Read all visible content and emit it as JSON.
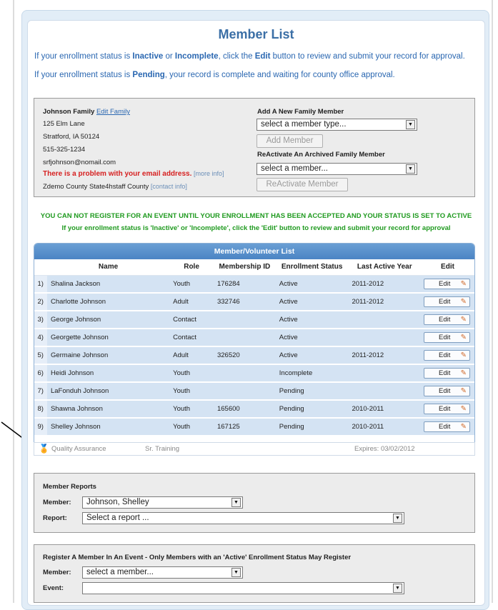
{
  "title": "Member List",
  "intro": {
    "line1_a": "If your enrollment status is ",
    "line1_inactive": "Inactive",
    "line1_or": " or ",
    "line1_incomplete": "Incomplete",
    "line1_b": ", click the ",
    "line1_edit": "Edit",
    "line1_c": " button to review and submit your record for approval.",
    "line2_a": "If your enrollment status is ",
    "line2_pending": "Pending",
    "line2_b": ", your record is complete and waiting for county office approval."
  },
  "family": {
    "name": "Johnson Family",
    "edit_link": "Edit Family",
    "address1": "125 Elm Lane",
    "address2": "Stratford, IA 50124",
    "phone": "515-325-1234",
    "email": "srfjohnson@nomail.com",
    "email_problem": "There is a problem with your email address.",
    "more_info": "[more info]",
    "county": "Zdemo County State4hstaff County",
    "contact_info": "[contact info]"
  },
  "add_member": {
    "label": "Add A New Family Member",
    "select_value": "select a member type...",
    "button": "Add Member"
  },
  "reactivate": {
    "label": "ReActivate An Archived Family Member",
    "select_value": "select a member...",
    "button": "ReActivate Member"
  },
  "warning": {
    "line1": "YOU CAN NOT REGISTER FOR AN EVENT UNTIL YOUR ENROLLMENT HAS BEEN ACCEPTED AND YOUR STATUS IS SET TO ACTIVE",
    "line2": "If your enrollment status is 'Inactive' or 'Incomplete', click the 'Edit' button to review and submit your record for approval"
  },
  "member_table": {
    "title": "Member/Volunteer List",
    "headers": [
      "Name",
      "Role",
      "Membership ID",
      "Enrollment Status",
      "Last Active Year",
      "Edit"
    ],
    "edit_label": "Edit",
    "rows": [
      {
        "num": "1)",
        "name": "Shalina Jackson",
        "role": "Youth",
        "id": "176284",
        "status": "Active",
        "year": "2011-2012"
      },
      {
        "num": "2)",
        "name": "Charlotte Johnson",
        "role": "Adult",
        "id": "332746",
        "status": "Active",
        "year": "2011-2012"
      },
      {
        "num": "3)",
        "name": "George Johnson",
        "role": "Contact",
        "id": "",
        "status": "Active",
        "year": ""
      },
      {
        "num": "4)",
        "name": "Georgette Johnson",
        "role": "Contact",
        "id": "",
        "status": "Active",
        "year": ""
      },
      {
        "num": "5)",
        "name": "Germaine Johnson",
        "role": "Adult",
        "id": "326520",
        "status": "Active",
        "year": "2011-2012"
      },
      {
        "num": "6)",
        "name": "Heidi Johnson",
        "role": "Youth",
        "id": "",
        "status": "Incomplete",
        "year": ""
      },
      {
        "num": "7)",
        "name": "LaFonduh Johnson",
        "role": "Youth",
        "id": "",
        "status": "Pending",
        "year": ""
      },
      {
        "num": "8)",
        "name": "Shawna Johnson",
        "role": "Youth",
        "id": "165600",
        "status": "Pending",
        "year": "2010-2011"
      },
      {
        "num": "9)",
        "name": "Shelley Johnson",
        "role": "Youth",
        "id": "167125",
        "status": "Pending",
        "year": "2010-2011"
      }
    ],
    "qa": {
      "label": "Quality Assurance",
      "training": "Sr. Training",
      "expires": "Expires: 03/02/2012"
    }
  },
  "reports": {
    "title": "Member Reports",
    "member_label": "Member:",
    "member_value": "Johnson, Shelley",
    "report_label": "Report:",
    "report_value": "Select a report ..."
  },
  "register": {
    "title": "Register A Member In An Event - Only Members with an 'Active' Enrollment Status May Register",
    "member_label": "Member:",
    "member_value": "select a member...",
    "event_label": "Event:",
    "event_value": ""
  }
}
